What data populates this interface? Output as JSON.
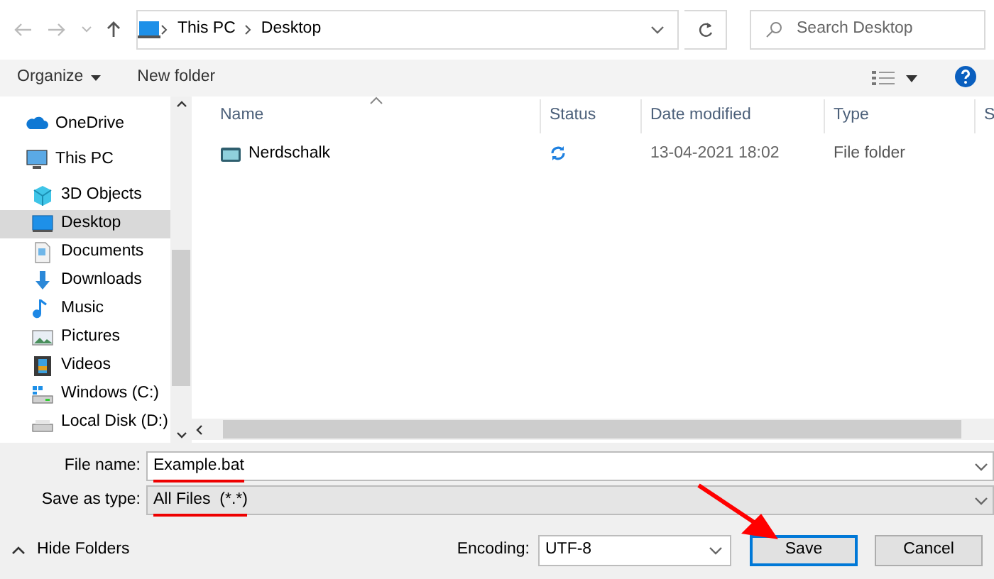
{
  "address_bar": {
    "path": [
      "This PC",
      "Desktop"
    ],
    "search_placeholder": "Search Desktop"
  },
  "toolbar": {
    "organize": "Organize",
    "new_folder": "New folder"
  },
  "sidebar": {
    "items": [
      {
        "label": "OneDrive",
        "kind": "cloud",
        "selected": false
      },
      {
        "label": "This PC",
        "kind": "pc",
        "selected": false,
        "children": [
          {
            "label": "3D Objects",
            "kind": "cube",
            "selected": false
          },
          {
            "label": "Desktop",
            "kind": "desktop",
            "selected": true
          },
          {
            "label": "Documents",
            "kind": "document",
            "selected": false
          },
          {
            "label": "Downloads",
            "kind": "download",
            "selected": false
          },
          {
            "label": "Music",
            "kind": "music",
            "selected": false
          },
          {
            "label": "Pictures",
            "kind": "pictures",
            "selected": false
          },
          {
            "label": "Videos",
            "kind": "video",
            "selected": false
          },
          {
            "label": "Windows (C:)",
            "kind": "drive",
            "selected": false
          },
          {
            "label": "Local Disk (D:)",
            "kind": "disk",
            "selected": false
          }
        ]
      }
    ]
  },
  "table": {
    "columns": [
      "Name",
      "Status",
      "Date modified",
      "Type",
      "S"
    ],
    "rows": [
      {
        "name": "Nerdschalk",
        "synced": true,
        "date": "13-04-2021 18:02",
        "type": "File folder"
      }
    ]
  },
  "form": {
    "file_name_label": "File name:",
    "file_name": "Example.bat",
    "type_label": "Save as type:",
    "type": "All Files  (*.*)",
    "hide_folders": "Hide Folders",
    "encoding_label": "Encoding:",
    "encoding": "UTF-8"
  },
  "buttons": [
    {
      "label": "Save",
      "default": true
    },
    {
      "label": "Cancel",
      "default": false
    }
  ]
}
